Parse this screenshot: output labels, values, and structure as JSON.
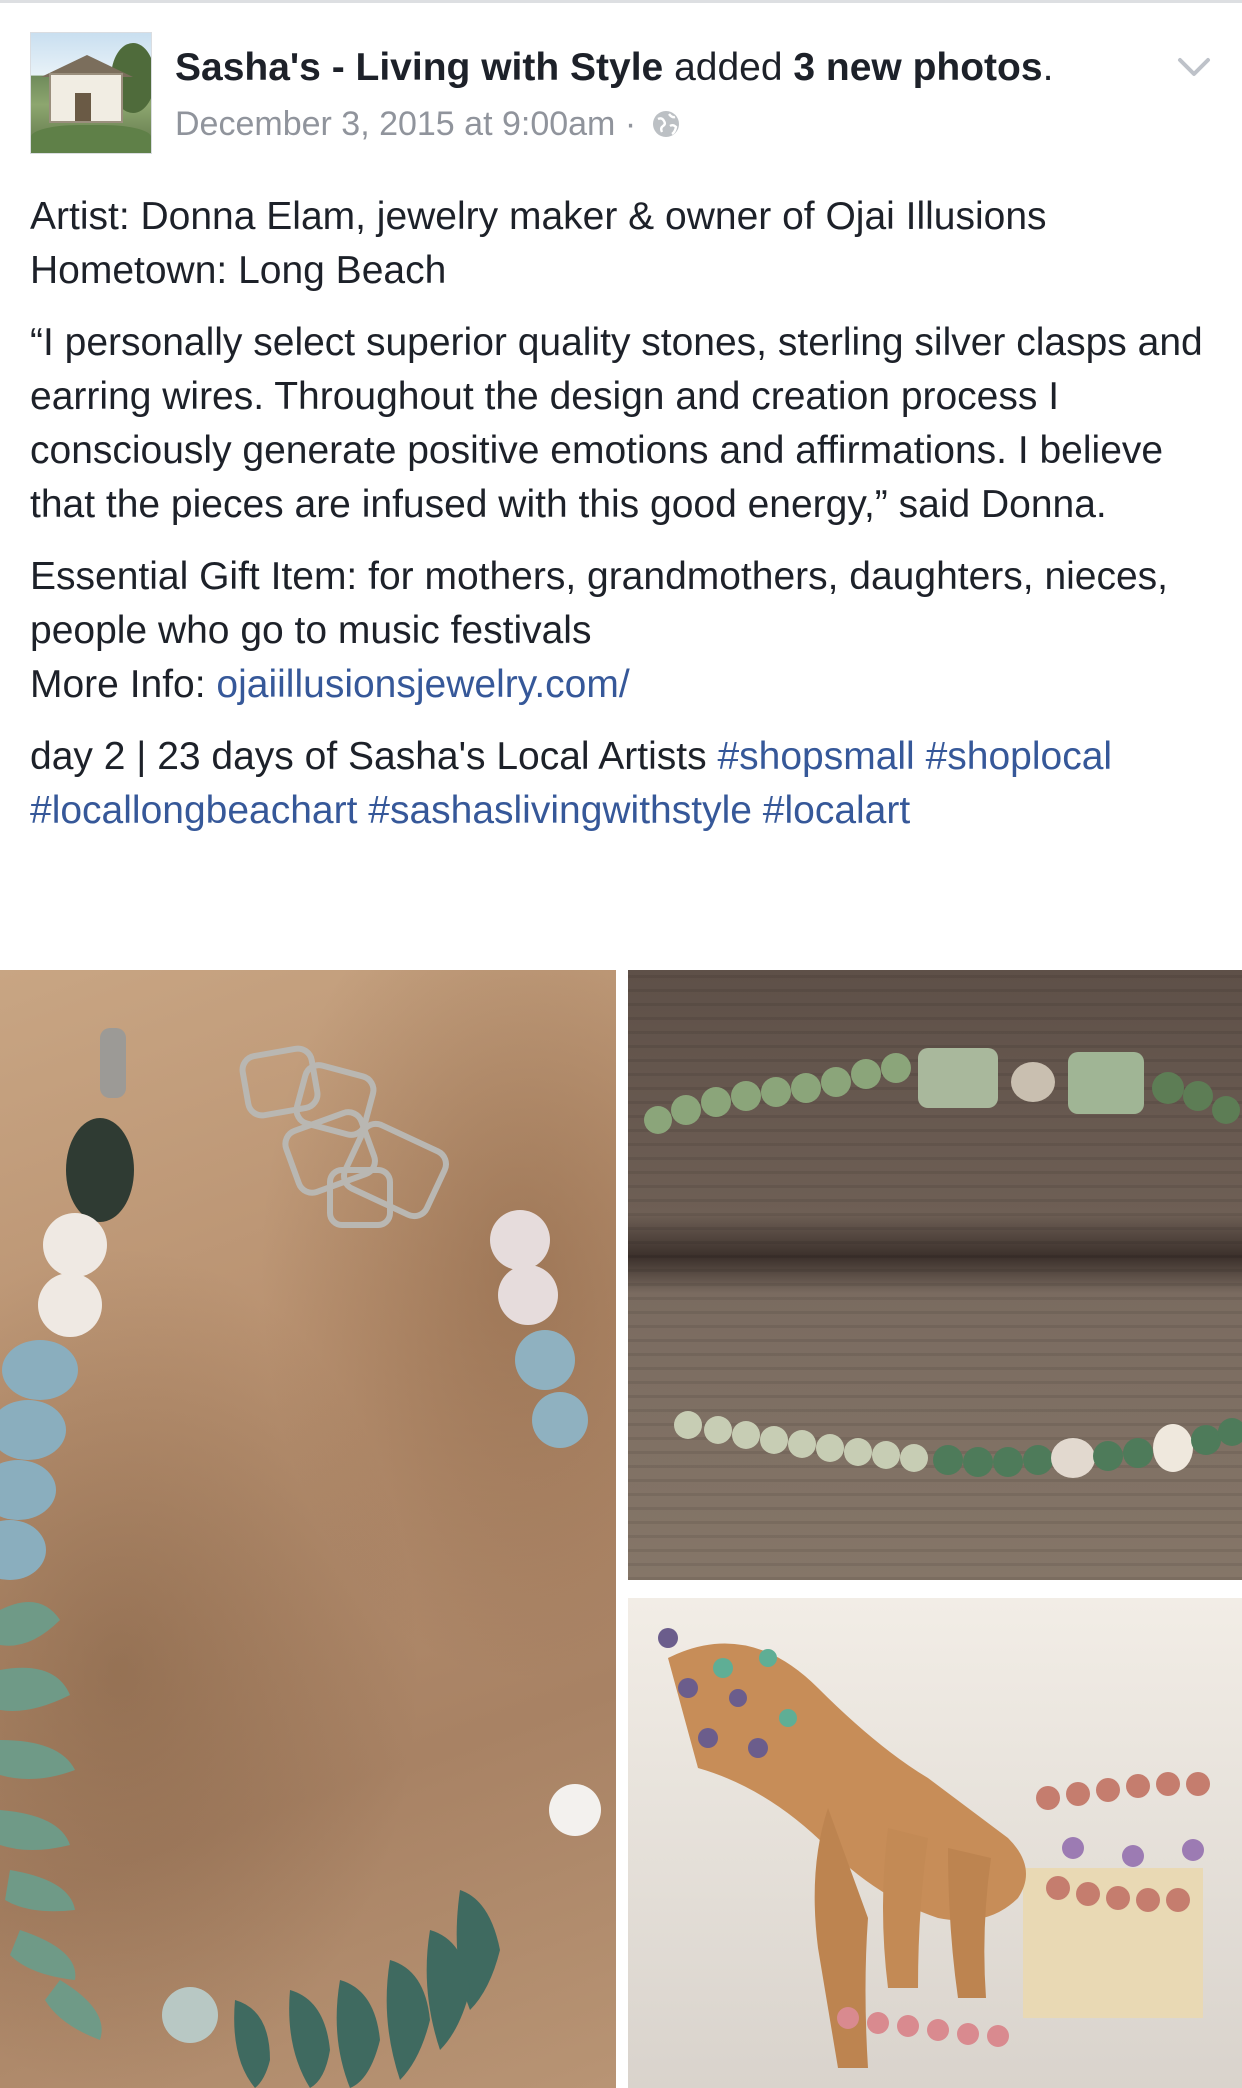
{
  "post": {
    "page_name": "Sasha's - Living with Style",
    "action_text": "added",
    "count_text": "3 new photos",
    "period": ".",
    "timestamp": "December 3, 2015 at 9:00am",
    "separator": "·",
    "privacy_icon": "globe-icon",
    "menu_icon": "chevron-down-icon"
  },
  "content": {
    "line1": "Artist: Donna Elam, jewelry maker & owner of Ojai Illusions",
    "line2": "Hometown: Long Beach",
    "quote": "“I personally select superior quality stones, sterling silver clasps and earring wires. Throughout the design and creation process I consciously generate positive emotions and affirmations. I believe that the pieces are infused with this good energy,” said Donna.",
    "gift_line": "Essential Gift Item: for mothers, grandmothers, daughters, nieces, people who go to music festivals",
    "more_info_label": "More Info: ",
    "more_info_link": "ojaiillusionsjewelry.com/",
    "day_text": "day 2 | 23 days of Sasha's Local Artists ",
    "hashtags": [
      "#shopsmall",
      "#shoplocal",
      "#locallongbeachart",
      "#sashaslivingwithstyle",
      "#localart"
    ]
  },
  "photos": [
    {
      "alt": "stone necklace on sand"
    },
    {
      "alt": "green bead necklace on wood"
    },
    {
      "alt": "bracelets on wooden hand"
    }
  ],
  "colors": {
    "link": "#365899",
    "meta": "#90949c",
    "text": "#1d2129"
  }
}
